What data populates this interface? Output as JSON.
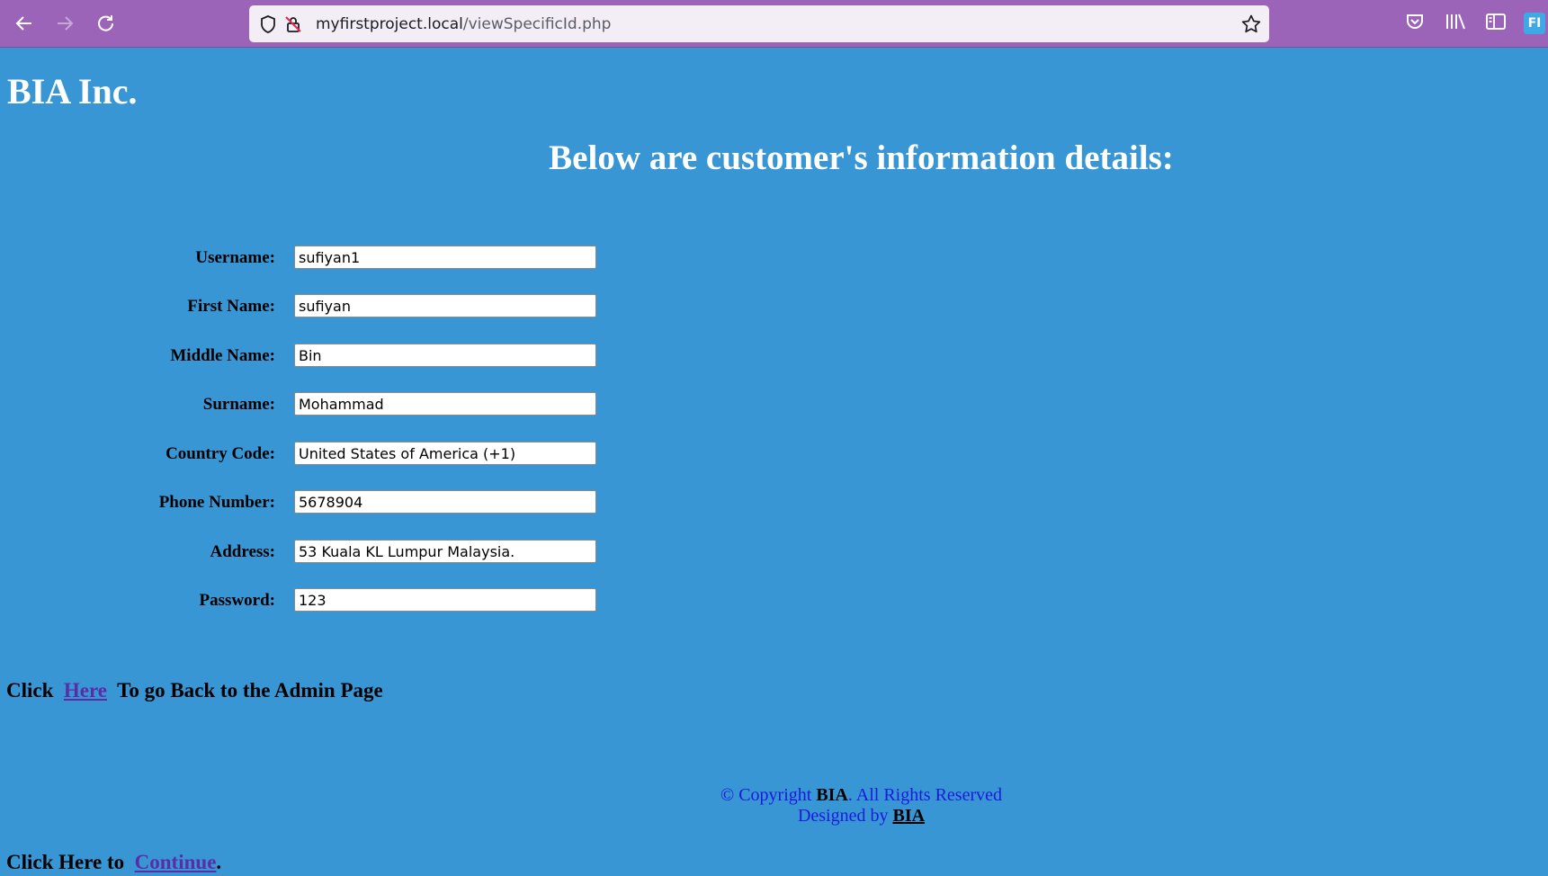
{
  "browser": {
    "url_host": "myfirstproject.local",
    "url_path": "/viewSpecificId.php",
    "ext_badge": "FI"
  },
  "page": {
    "brand": "BIA Inc.",
    "heading": "Below are customer's information details:"
  },
  "form": {
    "fields": [
      {
        "label": "Username:",
        "value": "sufiyan1"
      },
      {
        "label": "First Name:",
        "value": "sufiyan"
      },
      {
        "label": "Middle Name:",
        "value": "Bin"
      },
      {
        "label": "Surname:",
        "value": "Mohammad"
      },
      {
        "label": "Country Code:",
        "value": "United States of America (+1)"
      },
      {
        "label": "Phone Number:",
        "value": "5678904"
      },
      {
        "label": "Address:",
        "value": "53 Kuala KL Lumpur Malaysia."
      },
      {
        "label": "Password:",
        "value": "123"
      }
    ]
  },
  "back_link": {
    "prefix": "Click",
    "link_text": "Here",
    "suffix": "To go Back to the Admin Page"
  },
  "footer": {
    "copyright_symbol": "© Copyright",
    "brand": "BIA",
    "rights": ". All Rights Reserved",
    "designed_by": "Designed by",
    "designer": "BIA"
  },
  "continue_link": {
    "prefix": "Click Here to",
    "link_text": "Continue",
    "suffix": "."
  },
  "colors": {
    "page_bg": "#3996d4",
    "toolbar_bg": "#9c64b8",
    "link": "#5b2ca7",
    "footer_text": "#1919e0"
  }
}
